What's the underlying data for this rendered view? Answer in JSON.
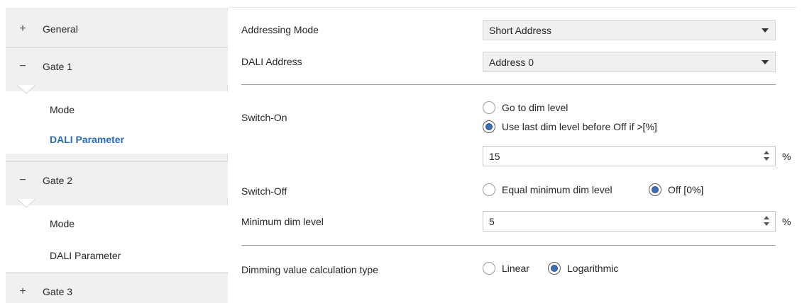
{
  "sidebar": {
    "groups": [
      {
        "symbol": "+",
        "label": "General"
      },
      {
        "symbol": "−",
        "label": "Gate 1"
      },
      {
        "symbol": "−",
        "label": "Gate 2"
      },
      {
        "symbol": "+",
        "label": "Gate 3"
      }
    ],
    "gate1_items": [
      "Mode",
      "DALI Parameter"
    ],
    "gate2_items": [
      "Mode",
      "DALI Parameter"
    ]
  },
  "params": {
    "addressing_mode": {
      "label": "Addressing Mode",
      "value": "Short Address"
    },
    "dali_address": {
      "label": "DALI Address",
      "value": "Address 0"
    },
    "switch_on": {
      "label": "Switch-On",
      "options": [
        "Go to dim level",
        "Use last dim level before Off if >[%]"
      ],
      "selected": 1,
      "value": "15",
      "unit": "%"
    },
    "switch_off": {
      "label": "Switch-Off",
      "options": [
        "Equal minimum dim level",
        "Off [0%]"
      ],
      "selected": 1
    },
    "minimum_dim_level": {
      "label": "Minimum dim level",
      "value": "5",
      "unit": "%"
    },
    "dimming_calc": {
      "label": "Dimming value calculation type",
      "options": [
        "Linear",
        "Logarithmic"
      ],
      "selected": 1
    }
  },
  "colors": {
    "accent": "#2a6cb3",
    "radio_fill": "#3c6db5",
    "sidebar_bg": "#f0f0f0"
  }
}
